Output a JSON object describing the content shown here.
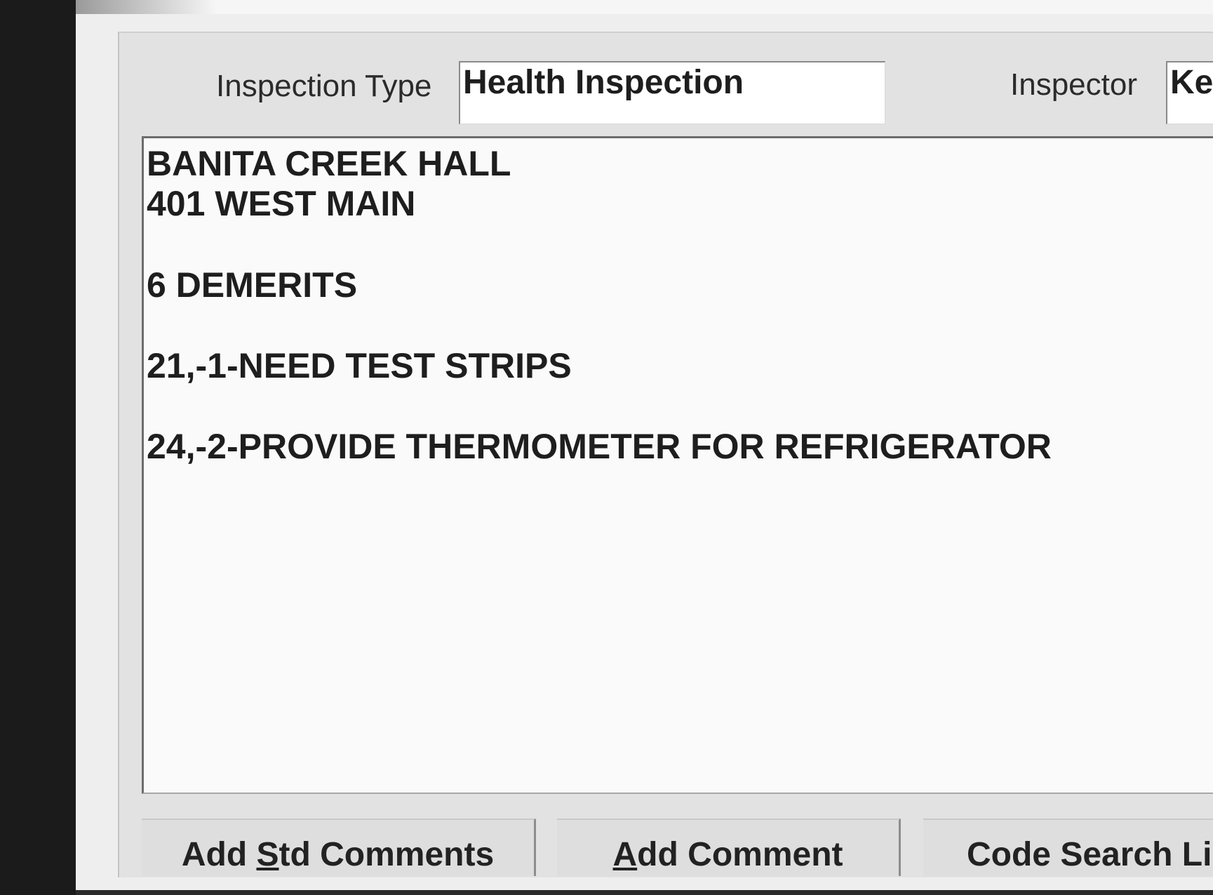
{
  "form": {
    "inspection_type_label": "Inspection Type",
    "inspection_type_value": "Health Inspection",
    "inspector_label": "Inspector",
    "inspector_value": "Ke"
  },
  "comments": {
    "lines": [
      "BANITA CREEK HALL",
      "401 WEST MAIN",
      "6 DEMERITS",
      "21,-1-NEED TEST STRIPS",
      "24,-2-PROVIDE THERMOMETER FOR REFRIGERATOR"
    ]
  },
  "buttons": {
    "add_std_pre": "Add ",
    "add_std_key": "S",
    "add_std_post": "td Comments",
    "add_comment_key": "A",
    "add_comment_post": "dd Comment",
    "code_search": "Code Search Li"
  },
  "colors": {
    "panel": "#e2e2e2",
    "field_bg": "#ffffff",
    "text": "#1e1e1e",
    "scan_edge": "#1b1b1b"
  }
}
